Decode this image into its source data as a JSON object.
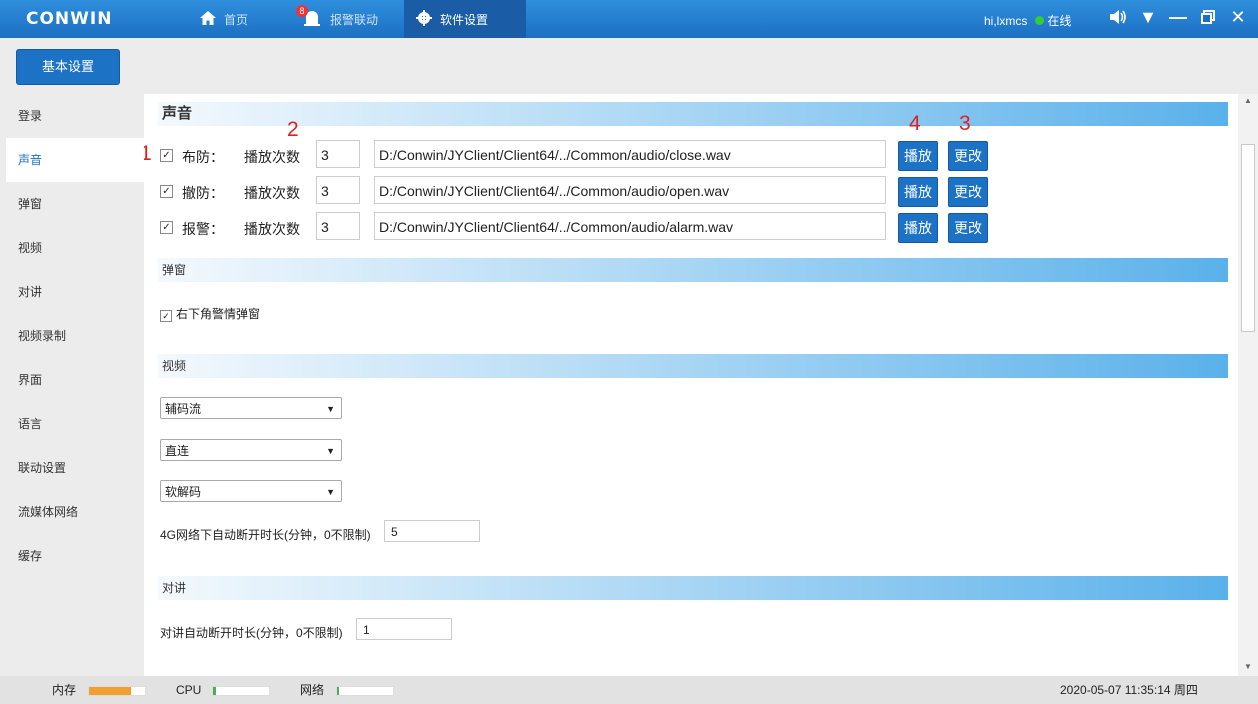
{
  "titlebar": {
    "logo": "CONWIN",
    "nav": [
      {
        "label": "首页",
        "icon": "home-icon"
      },
      {
        "label": "报警联动",
        "icon": "alarm-icon",
        "badge": "8"
      },
      {
        "label": "软件设置",
        "icon": "gear-icon"
      }
    ],
    "user": "hi,lxmcs",
    "status": "在线",
    "controls": [
      "speaker-icon",
      "dropdown-icon",
      "minimize-icon",
      "restore-icon",
      "close-icon"
    ]
  },
  "toolbar": {
    "basic_settings": "基本设置"
  },
  "sidebar": {
    "items": [
      "登录",
      "声音",
      "弹窗",
      "视频",
      "对讲",
      "视频录制",
      "界面",
      "语言",
      "联动设置",
      "流媒体网络",
      "缓存"
    ],
    "active": "声音"
  },
  "sound": {
    "header": "声音",
    "count_label": "播放次数",
    "play_label": "播放",
    "change_label": "更改",
    "rows": [
      {
        "label": "布防：",
        "count": "3",
        "path": "D:/Conwin/JYClient/Client64/../Common/audio/close.wav",
        "checked": true
      },
      {
        "label": "撤防：",
        "count": "3",
        "path": "D:/Conwin/JYClient/Client64/../Common/audio/open.wav",
        "checked": true
      },
      {
        "label": "报警：",
        "count": "3",
        "path": "D:/Conwin/JYClient/Client64/../Common/audio/alarm.wav",
        "checked": true
      }
    ],
    "annotations": [
      "1",
      "2",
      "3",
      "4"
    ]
  },
  "popup": {
    "header": "弹窗",
    "option": "右下角警情弹窗",
    "checked": true
  },
  "video": {
    "header": "视频",
    "selects": [
      "辅码流",
      "直连",
      "软解码"
    ],
    "timeout_label": "4G网络下自动断开时长(分钟，0不限制)",
    "timeout_value": "5"
  },
  "talk": {
    "header": "对讲",
    "timeout_label": "对讲自动断开时长(分钟，0不限制)",
    "timeout_value": "1"
  },
  "status": {
    "memory_label": "内存",
    "memory_level": 0.75,
    "memory_color": "#f0a030",
    "cpu_label": "CPU",
    "cpu_level": 0.05,
    "network_label": "网络",
    "network_level": 0.03,
    "level_color": "#4caf50",
    "datetime": "2020-05-07 11:35:14 周四"
  }
}
